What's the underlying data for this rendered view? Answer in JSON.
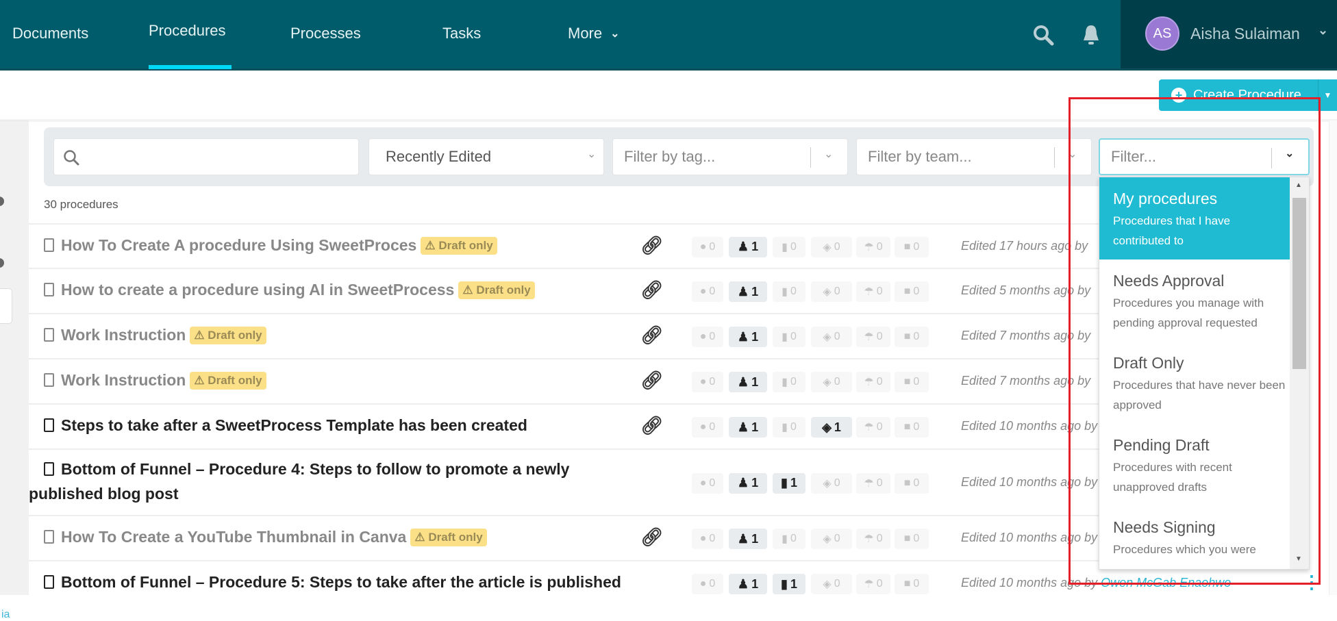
{
  "nav": {
    "items": [
      {
        "label": "Documents",
        "active": false
      },
      {
        "label": "Procedures",
        "active": true
      },
      {
        "label": "Processes",
        "active": false
      },
      {
        "label": "Tasks",
        "active": false
      },
      {
        "label": "More",
        "active": false
      }
    ],
    "search_icon": "search-icon",
    "bell_icon": "bell-icon"
  },
  "user": {
    "initials": "AS",
    "name": "Aisha Sulaiman"
  },
  "toolbar": {
    "create_label": "Create Procedure"
  },
  "filters": {
    "search_placeholder": "",
    "sort_value": "Recently Edited",
    "tag_placeholder": "Filter by tag...",
    "team_placeholder": "Filter by team...",
    "filter_placeholder": "Filter..."
  },
  "count_label": "30 procedures",
  "sidebar": {
    "link_fragment": "ia"
  },
  "draft_badge": "Draft only",
  "rows": [
    {
      "title": "How To Create A procedure Using SweetProces",
      "draft": true,
      "link": true,
      "stats": {
        "tags": "0",
        "members": "1",
        "docs": "0",
        "steps": "0",
        "approvals": "0",
        "folders": "0"
      },
      "edited": "Edited 17 hours ago by",
      "author": ""
    },
    {
      "title": "How to create a procedure using AI in SweetProcess",
      "draft": true,
      "link": true,
      "stats": {
        "tags": "0",
        "members": "1",
        "docs": "0",
        "steps": "0",
        "approvals": "0",
        "folders": "0"
      },
      "edited": "Edited 5 months ago by",
      "author": ""
    },
    {
      "title": "Work Instruction",
      "draft": true,
      "link": true,
      "stats": {
        "tags": "0",
        "members": "1",
        "docs": "0",
        "steps": "0",
        "approvals": "0",
        "folders": "0"
      },
      "edited": "Edited 7 months ago by",
      "author": ""
    },
    {
      "title": "Work Instruction",
      "draft": true,
      "link": true,
      "stats": {
        "tags": "0",
        "members": "1",
        "docs": "0",
        "steps": "0",
        "approvals": "0",
        "folders": "0"
      },
      "edited": "Edited 7 months ago by",
      "author": ""
    },
    {
      "title": "Steps to take after a SweetProcess Template has been created",
      "draft": false,
      "link": true,
      "stats": {
        "tags": "0",
        "members": "1",
        "docs": "0",
        "steps": "1",
        "approvals": "0",
        "folders": "0"
      },
      "edited": "Edited 10 months ago by",
      "author": ""
    },
    {
      "title": "Bottom of Funnel – Procedure 4: Steps to follow to promote a newly",
      "title2": "published blog post",
      "draft": false,
      "link": false,
      "stats": {
        "tags": "0",
        "members": "1",
        "docs": "1",
        "steps": "0",
        "approvals": "0",
        "folders": "0"
      },
      "edited": "Edited 10 months ago by",
      "author": ""
    },
    {
      "title": "How To Create a YouTube Thumbnail in Canva",
      "draft": true,
      "link": true,
      "stats": {
        "tags": "0",
        "members": "1",
        "docs": "0",
        "steps": "0",
        "approvals": "0",
        "folders": "0"
      },
      "edited": "Edited 10 months ago by",
      "author": ""
    },
    {
      "title": "Bottom of Funnel – Procedure 5: Steps to take after the article is published",
      "draft": false,
      "link": false,
      "stats": {
        "tags": "0",
        "members": "1",
        "docs": "1",
        "steps": "0",
        "approvals": "0",
        "folders": "0"
      },
      "edited": "Edited 10 months ago by",
      "author": "Owen McGab Enaohwo"
    }
  ],
  "dropdown": {
    "options": [
      {
        "title": "My procedures",
        "desc": "Procedures that I have contributed to",
        "active": true
      },
      {
        "title": "Needs Approval",
        "desc": "Procedures you manage with pending approval requested",
        "active": false
      },
      {
        "title": "Draft Only",
        "desc": "Procedures that have never been approved",
        "active": false
      },
      {
        "title": "Pending Draft",
        "desc": "Procedures with recent unapproved drafts",
        "active": false
      },
      {
        "title": "Needs Signing",
        "desc": "Procedures which you were",
        "active": false
      }
    ]
  },
  "colors": {
    "header_bg": "#005c6a",
    "user_area_bg": "#003f4a",
    "accent": "#1fbbd2",
    "active_tab_underline": "#00d8f5",
    "draft_badge_bg": "#fbe088",
    "highlight_border": "#e3202a",
    "avatar_bg": "#9a79d4"
  }
}
